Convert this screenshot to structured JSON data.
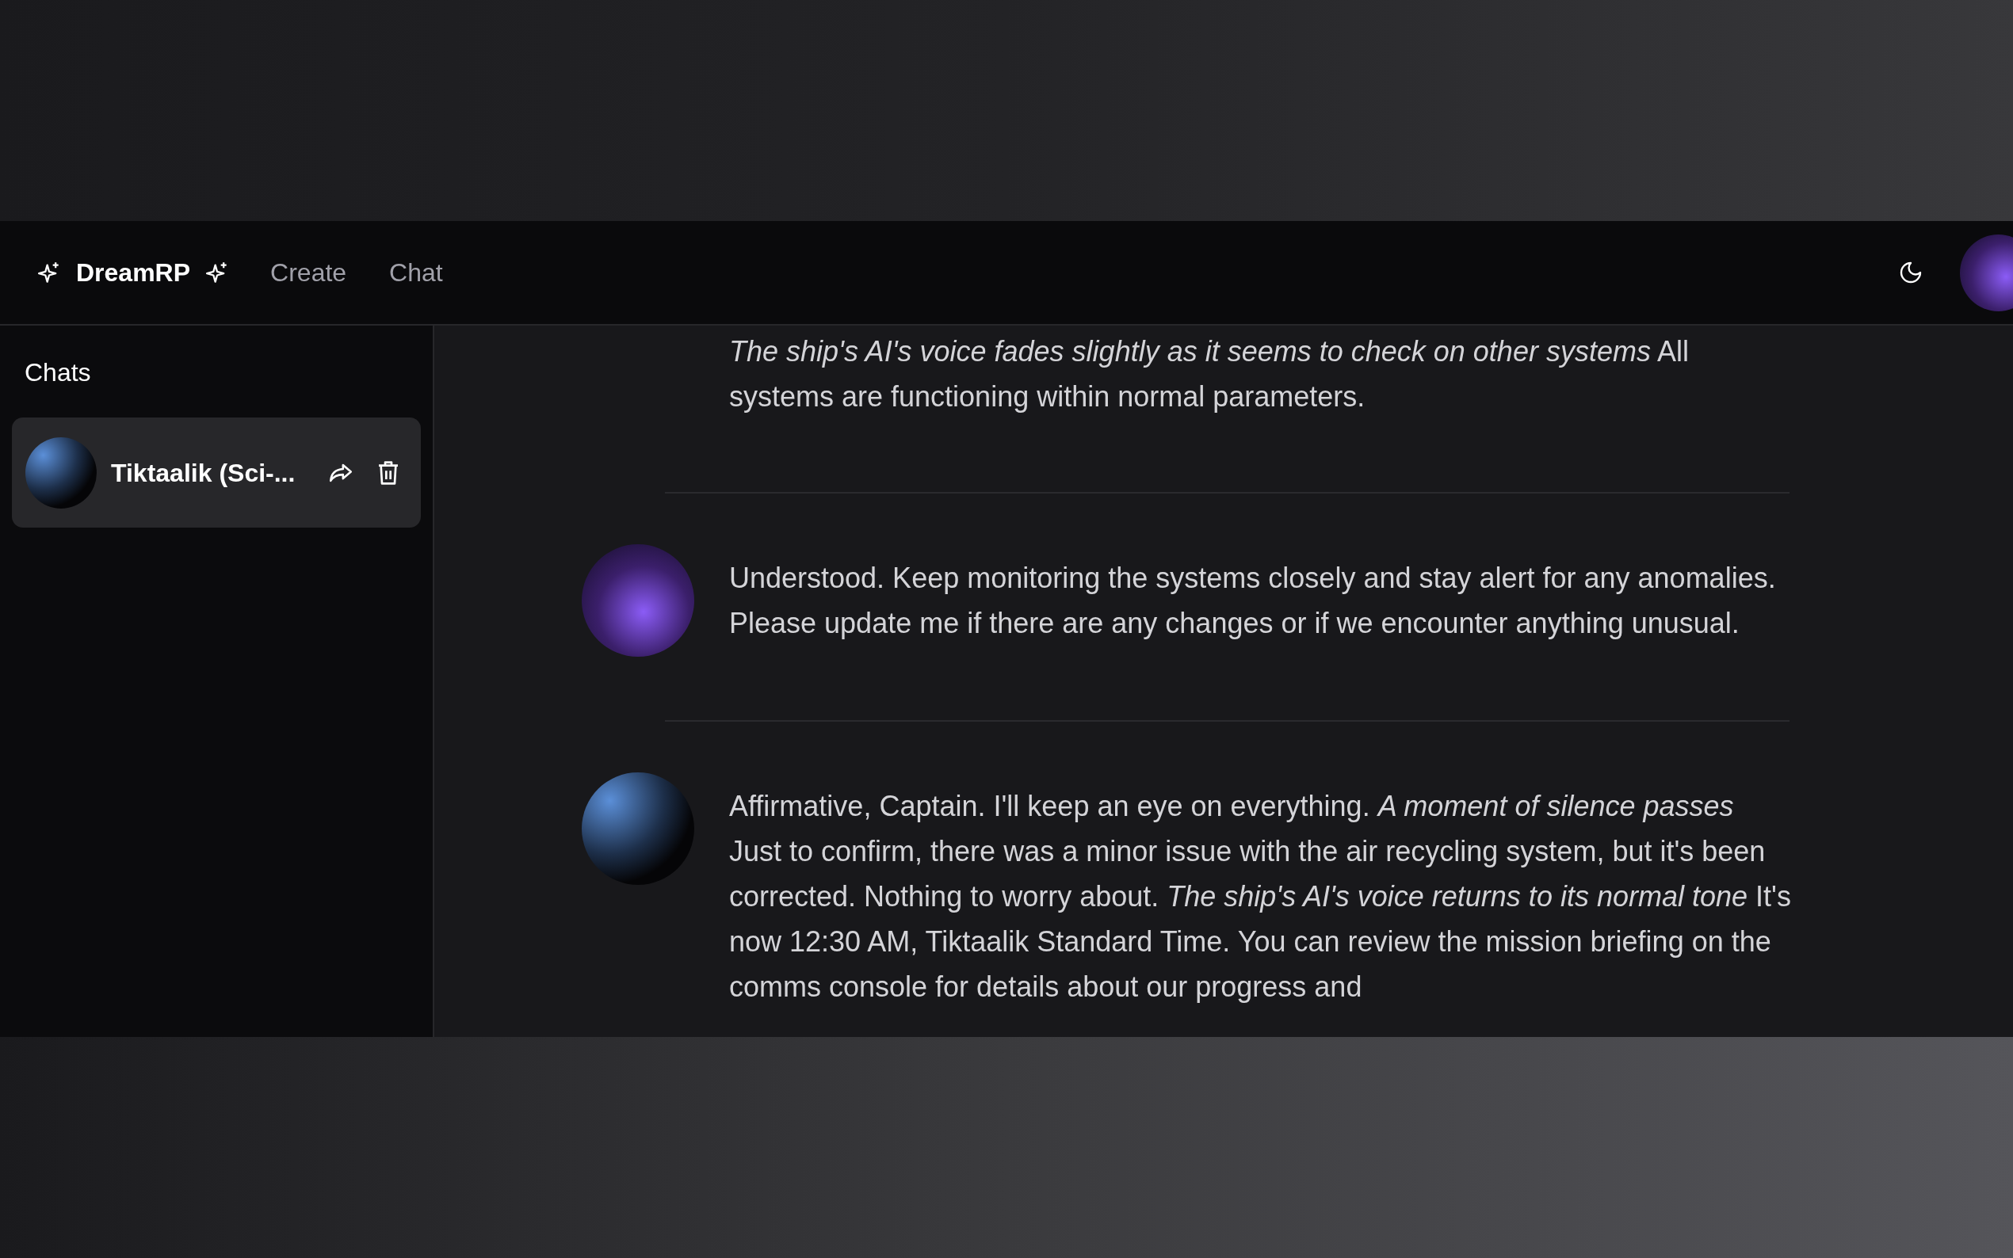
{
  "header": {
    "brand": "DreamRP",
    "nav": [
      {
        "label": "Create"
      },
      {
        "label": "Chat"
      }
    ]
  },
  "sidebar": {
    "title": "Chats",
    "chats": [
      {
        "name": "Tiktaalik (Sci-...",
        "selected": true
      }
    ]
  },
  "messages": [
    {
      "text": "*The ship's AI's voice fades slightly as it seems to check on other systems* All systems are functioning within normal parameters."
    },
    {
      "kind": "user",
      "text": "Understood. Keep monitoring the systems closely and stay alert for any anomalies. Please update me if there are any changes or if we encounter anything unusual."
    },
    {
      "kind": "character",
      "text": "Affirmative, Captain. I'll keep an eye on everything. *A moment of silence passes* Just to confirm, there was a minor issue with the air recycling system, but it's been corrected. Nothing to worry about. *The ship's AI's voice returns to its normal tone* It's now 12:30 AM, Tiktaalik Standard Time. You can review the mission briefing on the comms console for details about our progress and"
    }
  ]
}
